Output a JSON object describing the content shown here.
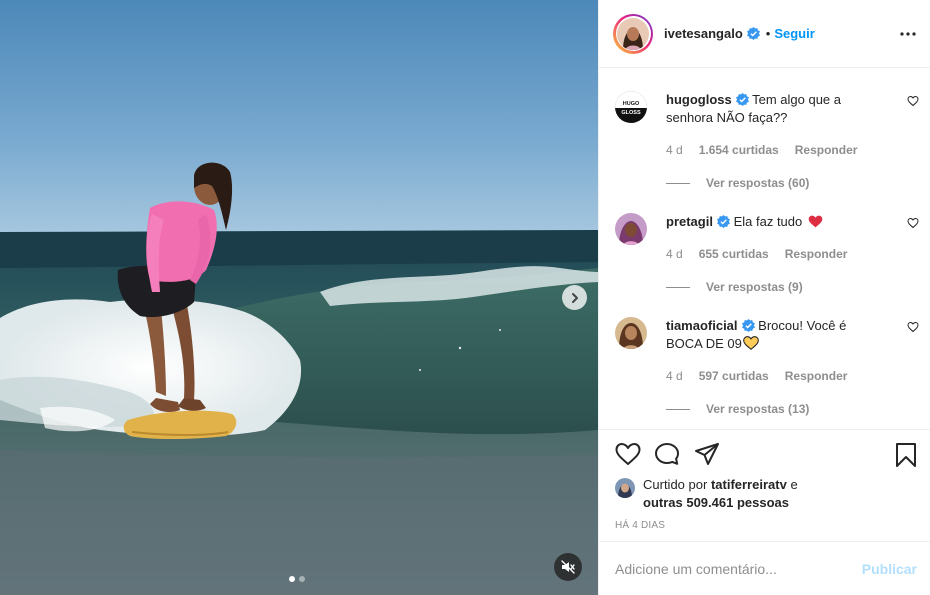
{
  "post": {
    "username": "ivetesangalo",
    "separator": "•",
    "follow_label": "Seguir"
  },
  "comments": [
    {
      "username": "hugogloss",
      "avatar_text_1": "HUGO",
      "avatar_text_2": "GLOSS",
      "text": "Tem algo que a senhora NÃO faça??",
      "time": "4 d",
      "likes": "1.654 curtidas",
      "reply_label": "Responder",
      "view_replies": "Ver respostas (60)"
    },
    {
      "username": "pretagil",
      "text": "Ela faz tudo",
      "emoji": "red-heart-emoji",
      "time": "4 d",
      "likes": "655 curtidas",
      "reply_label": "Responder",
      "view_replies": "Ver respostas (9)"
    },
    {
      "username": "tiamaoficial",
      "text": "Brocou! Você é BOCA DE 09",
      "emoji": "yellow-heart-emoji",
      "time": "4 d",
      "likes": "597 curtidas",
      "reply_label": "Responder",
      "view_replies": "Ver respostas (13)"
    }
  ],
  "likes": {
    "prefix": "Curtido por",
    "user": "tatiferreiratv",
    "conj": "e",
    "others": "outras 509.461 pessoas"
  },
  "date": "HÁ 4 DIAS",
  "add_comment": {
    "placeholder": "Adicione um comentário...",
    "publish_label": "Publicar"
  },
  "media": {
    "slides": 2,
    "active_slide": 1,
    "icons": [
      "chevron-right-icon",
      "mute-icon"
    ]
  },
  "colors": {
    "link_blue": "#0095f6",
    "publish_disabled": "#b2dffc",
    "muted_text": "#8e8e8e",
    "verified_blue": "#3897f0"
  }
}
